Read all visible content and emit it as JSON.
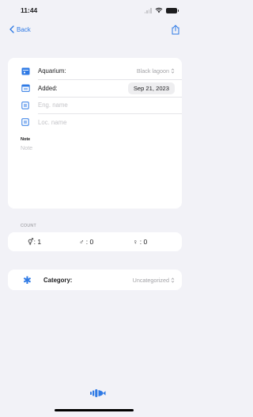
{
  "status": {
    "time": "11:44"
  },
  "nav": {
    "back_label": "Back",
    "share_icon": "share-icon"
  },
  "fields": {
    "aquarium": {
      "label": "Aquarium:",
      "value": "Black lagoon",
      "icon": "tank-icon"
    },
    "added": {
      "label": "Added:",
      "value": "Sep 21, 2023",
      "icon": "calendar-icon"
    },
    "eng_name": {
      "placeholder": "Eng. name",
      "icon": "name-tag-icon"
    },
    "loc_name": {
      "placeholder": "Loc. name",
      "icon": "name-tag-icon"
    }
  },
  "note": {
    "label": "Note",
    "placeholder": "Note"
  },
  "count": {
    "section_label": "COUNT",
    "unsexed": "⚥: 1",
    "male": "♂ : 0",
    "female": "♀ : 0"
  },
  "category": {
    "label": "Category:",
    "value": "Uncategorized",
    "icon": "asterisk-icon"
  },
  "colors": {
    "accent": "#2f7ae5",
    "background": "#f2f2f7"
  }
}
